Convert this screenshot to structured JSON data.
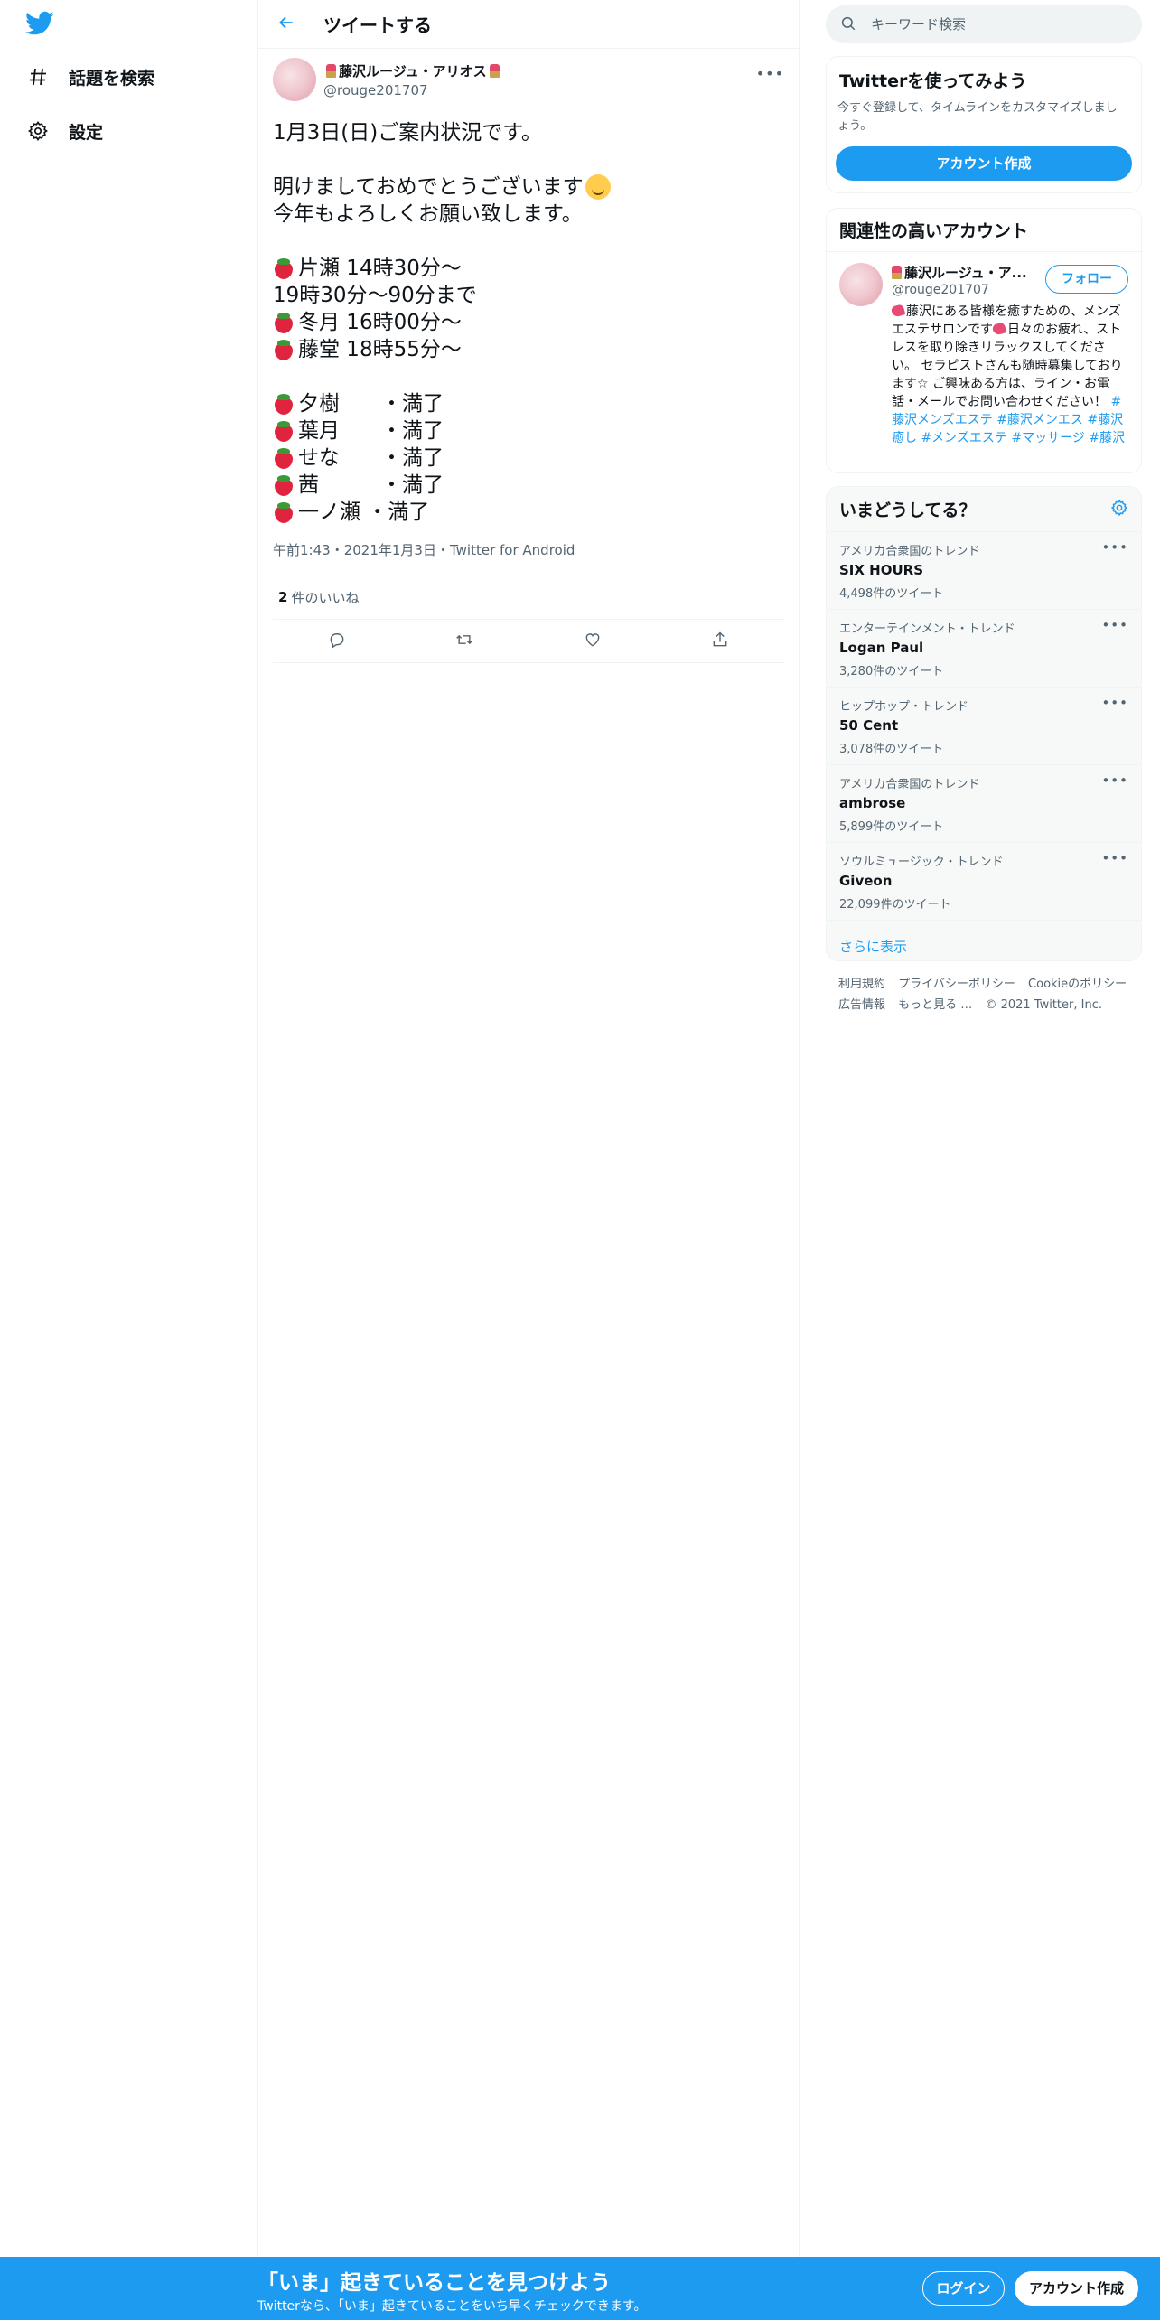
{
  "nav": {
    "logo_icon": "twitter-bird-icon",
    "items": [
      {
        "label": "話題を検索",
        "icon": "hashtag-icon"
      },
      {
        "label": "設定",
        "icon": "gear-icon"
      }
    ]
  },
  "header": {
    "title": "ツイートする",
    "back_icon": "arrow-left-icon"
  },
  "tweet": {
    "display_name": "藤沢ルージュ・アリオス",
    "handle": "@rouge201707",
    "lines": [
      {
        "text": "1月3日(日)ご案内状況です。"
      },
      {
        "text": ""
      },
      {
        "text": "明けましておめでとうございます",
        "emoji": "smiling-face-icon"
      },
      {
        "text": "今年もよろしくお願い致します。"
      },
      {
        "text": ""
      },
      {
        "text": "片瀬 14時30分〜",
        "emoji": "strawberry-icon"
      },
      {
        "text": "19時30分〜90分まで"
      },
      {
        "text": "冬月 16時00分～",
        "emoji": "strawberry-icon"
      },
      {
        "text": "藤堂 18時55分～",
        "emoji": "strawberry-icon"
      },
      {
        "text": ""
      },
      {
        "text": "夕樹　　・満了",
        "emoji": "strawberry-icon"
      },
      {
        "text": "葉月　　・満了",
        "emoji": "strawberry-icon"
      },
      {
        "text": "せな　　・満了",
        "emoji": "strawberry-icon"
      },
      {
        "text": "茜　　　・満了",
        "emoji": "strawberry-icon"
      },
      {
        "text": "一ノ瀬 ・満了",
        "emoji": "strawberry-icon"
      }
    ],
    "time": "午前1:43",
    "date": "2021年1月3日",
    "source": "Twitter for Android",
    "separator": "・",
    "likes_count": "2",
    "likes_label": "件のいいね"
  },
  "search": {
    "placeholder": "キーワード検索"
  },
  "signup_card": {
    "title": "Twitterを使ってみよう",
    "desc": "今すぐ登録して、タイムラインをカスタマイズしましょう。",
    "button": "アカウント作成"
  },
  "related": {
    "title": "関連性の高いアカウント",
    "name": "藤沢ルージュ・ア...",
    "handle": "@rouge201707",
    "follow": "フォロー",
    "bio_1": "藤沢にある皆様を癒すための、メンズエステサロンです",
    "bio_2": "日々のお疲れ、ストレスを取り除きリラックスしてください。 セラピストさんも随時募集しております☆ ご興味ある方は、ライン・お電話・メールでお問い合わせください！ ",
    "tags": [
      "#藤沢メンズエステ",
      "#藤沢メンエス",
      "#藤沢癒し",
      "#メンズエステ",
      "#マッサージ",
      "#藤沢"
    ]
  },
  "trends": {
    "title": "いまどうしてる？",
    "items": [
      {
        "meta": "アメリカ合衆国のトレンド",
        "name": "SIX HOURS",
        "count": "4,498件のツイート"
      },
      {
        "meta": "エンターテインメント・トレンド",
        "name": "Logan Paul",
        "count": "3,280件のツイート"
      },
      {
        "meta": "ヒップホップ・トレンド",
        "name": "50 Cent",
        "count": "3,078件のツイート"
      },
      {
        "meta": "アメリカ合衆国のトレンド",
        "name": "ambrose",
        "count": "5,899件のツイート"
      },
      {
        "meta": "ソウルミュージック・トレンド",
        "name": "Giveon",
        "count": "22,099件のツイート"
      }
    ],
    "show_more": "さらに表示"
  },
  "footer": {
    "terms": "利用規約",
    "privacy": "プライバシーポリシー",
    "cookie": "Cookieのポリシー",
    "ads": "広告情報",
    "more": "もっと見る …",
    "copyright": "© 2021 Twitter, Inc."
  },
  "banner": {
    "title": "「いま」起きていることを見つけよう",
    "sub": "Twitterなら、「いま」起きていることをいち早くチェックできます。",
    "login": "ログイン",
    "signup": "アカウント作成"
  },
  "colors": {
    "accent": "#1d9bf0",
    "text": "#0f1419",
    "muted": "#536471"
  }
}
